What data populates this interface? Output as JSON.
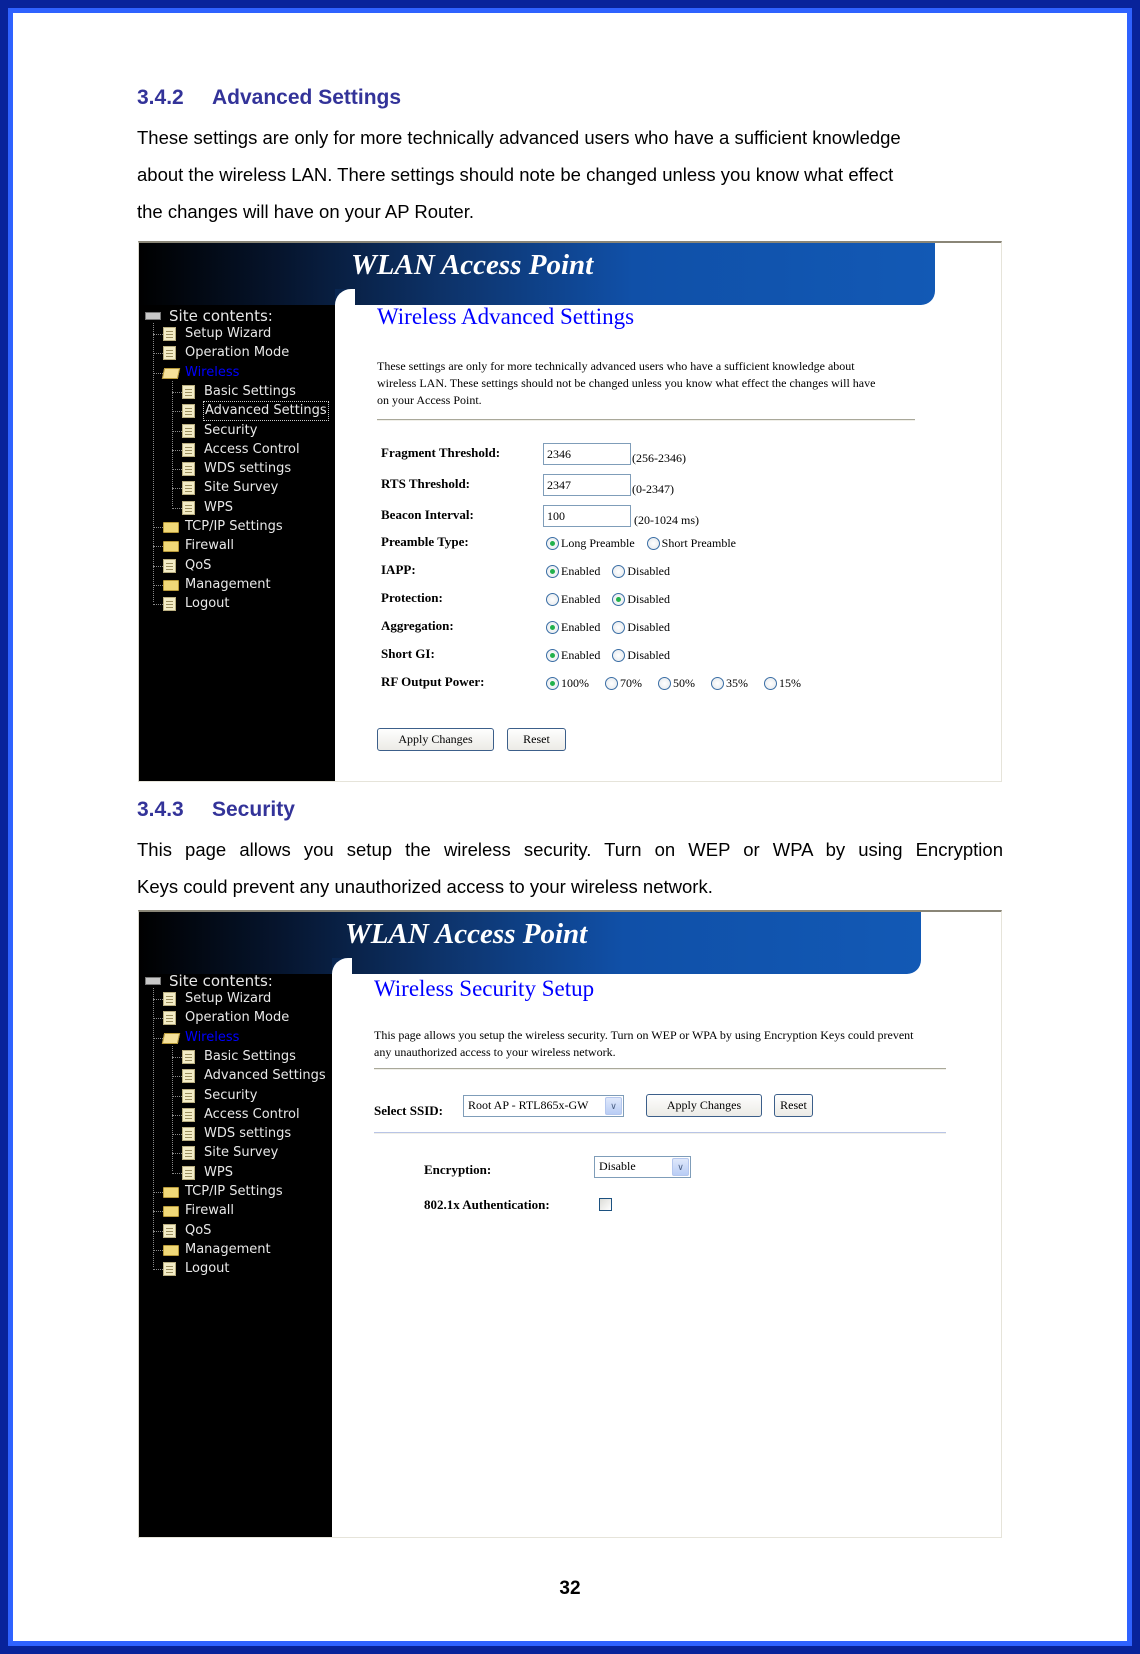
{
  "sections": [
    {
      "number": "3.4.2",
      "title": "Advanced Settings",
      "paragraph_lines": [
        "These settings are only for more technically advanced users who have a sufficient knowledge",
        "about the wireless LAN. There settings should note be changed unless you know what effect",
        "the changes will have on your AP Router."
      ]
    },
    {
      "number": "3.4.3",
      "title": "Security",
      "paragraph_lines": [
        "This page allows you setup the wireless security. Turn on WEP or WPA by using Encryption",
        "Keys could prevent any unauthorized access to your wireless network."
      ]
    }
  ],
  "page_number": "32",
  "colors": {
    "heading": "#333399",
    "frame_outer": "#08239a",
    "frame_inner": "#2f62ff",
    "banner_blue": "#1259b5",
    "page_title_blue": "#0000ff"
  },
  "screenshot_common": {
    "banner_title": "WLAN Access Point",
    "sidebar": {
      "root_label": "Site contents:",
      "root_icon": "server-icon",
      "items": [
        {
          "label": "Setup Wizard",
          "icon": "document-icon",
          "level": 1
        },
        {
          "label": "Operation Mode",
          "icon": "document-icon",
          "level": 1
        },
        {
          "label": "Wireless",
          "icon": "folder-open-icon",
          "level": 1,
          "active": true
        },
        {
          "label": "Basic Settings",
          "icon": "document-icon",
          "level": 2
        },
        {
          "label": "Advanced Settings",
          "icon": "document-icon",
          "level": 2
        },
        {
          "label": "Security",
          "icon": "document-icon",
          "level": 2
        },
        {
          "label": "Access Control",
          "icon": "document-icon",
          "level": 2
        },
        {
          "label": "WDS settings",
          "icon": "document-icon",
          "level": 2
        },
        {
          "label": "Site Survey",
          "icon": "document-icon",
          "level": 2
        },
        {
          "label": "WPS",
          "icon": "document-icon",
          "level": 2
        },
        {
          "label": "TCP/IP Settings",
          "icon": "folder-icon",
          "level": 1
        },
        {
          "label": "Firewall",
          "icon": "folder-icon",
          "level": 1
        },
        {
          "label": "QoS",
          "icon": "document-icon",
          "level": 1
        },
        {
          "label": "Management",
          "icon": "folder-icon",
          "level": 1
        },
        {
          "label": "Logout",
          "icon": "document-icon",
          "level": 1
        }
      ]
    }
  },
  "advanced_screen": {
    "focused_sidebar_item": "Advanced Settings",
    "title": "Wireless Advanced Settings",
    "description_lines": [
      "These settings are only for more technically advanced users who have a sufficient knowledge about",
      "wireless LAN. These settings should not be changed unless you know what effect the changes will have",
      "on your Access Point."
    ],
    "text_fields": [
      {
        "label": "Fragment Threshold:",
        "value": "2346",
        "hint": "(256-2346)"
      },
      {
        "label": "RTS Threshold:",
        "value": "2347",
        "hint": "(0-2347)"
      },
      {
        "label": "Beacon Interval:",
        "value": "100",
        "hint": "(20-1024 ms)"
      }
    ],
    "radio_fields": [
      {
        "label": "Preamble Type:",
        "options": [
          "Long Preamble",
          "Short Preamble"
        ],
        "selected": "Long Preamble"
      },
      {
        "label": "IAPP:",
        "options": [
          "Enabled",
          "Disabled"
        ],
        "selected": "Enabled"
      },
      {
        "label": "Protection:",
        "options": [
          "Enabled",
          "Disabled"
        ],
        "selected": "Disabled"
      },
      {
        "label": "Aggregation:",
        "options": [
          "Enabled",
          "Disabled"
        ],
        "selected": "Enabled"
      },
      {
        "label": "Short GI:",
        "options": [
          "Enabled",
          "Disabled"
        ],
        "selected": "Enabled"
      },
      {
        "label": "RF Output Power:",
        "options": [
          "100%",
          "70%",
          "50%",
          "35%",
          "15%"
        ],
        "selected": "100%"
      }
    ],
    "apply_label": "Apply Changes",
    "reset_label": "Reset"
  },
  "security_screen": {
    "title": "Wireless Security Setup",
    "description_lines": [
      "This page allows you setup the wireless security. Turn on WEP or WPA by using Encryption Keys could prevent",
      "any unauthorized access to your wireless network."
    ],
    "ssid_label": "Select SSID:",
    "ssid_value": "Root AP - RTL865x-GW",
    "apply_label": "Apply Changes",
    "reset_label": "Reset",
    "encryption_label": "Encryption:",
    "encryption_value": "Disable",
    "auth_label": "802.1x Authentication:",
    "auth_checked": false
  }
}
